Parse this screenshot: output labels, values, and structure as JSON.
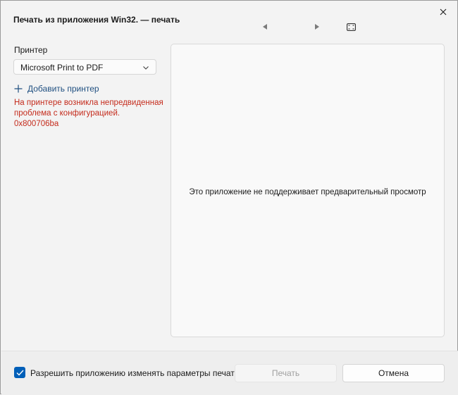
{
  "window": {
    "title": "Печать из приложения Win32. — печать"
  },
  "toolbar": {
    "close_icon": "close-icon",
    "prev_icon": "triangle-left-icon",
    "next_icon": "triangle-right-icon",
    "fit_icon": "fit-page-icon"
  },
  "sidebar": {
    "printer_label": "Принтер",
    "printer_selected": "Microsoft Print to PDF",
    "add_printer_label": "Добавить принтер",
    "error_message": "На принтере возникла непредвиденная проблема с конфигурацией. 0x800706ba"
  },
  "preview": {
    "message": "Это приложение не поддерживает предварительный просмотр"
  },
  "footer": {
    "allow_app_checkbox_label": "Разрешить приложению изменять параметры печати",
    "allow_app_checked": true,
    "print_button": "Печать",
    "print_enabled": false,
    "cancel_button": "Отмена"
  },
  "colors": {
    "accent": "#005fb8",
    "error": "#c42b1c",
    "link": "#1f4f80",
    "background": "#f3f3f3"
  }
}
